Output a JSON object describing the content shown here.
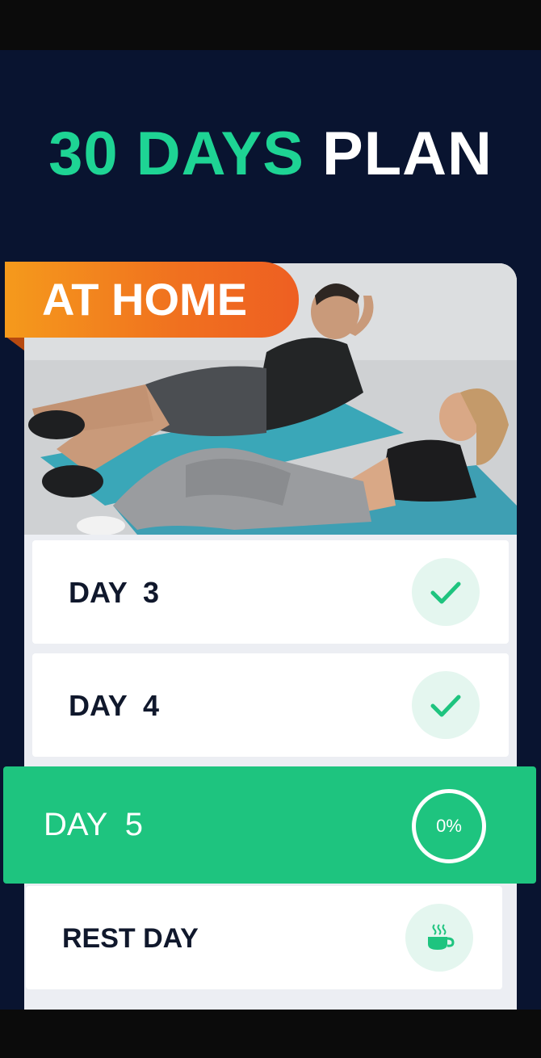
{
  "header": {
    "title_accent": "30 DAYS",
    "title_plain": "PLAN"
  },
  "plan": {
    "badge_label": "AT HOME",
    "photo_description_icon": "workout-photo"
  },
  "days": [
    {
      "label": "DAY  3",
      "status": "completed",
      "icon": "check-icon"
    },
    {
      "label": "DAY  4",
      "status": "completed",
      "icon": "check-icon"
    },
    {
      "label": "DAY  5",
      "status": "current",
      "progress": "0%"
    },
    {
      "label": "REST DAY",
      "status": "rest",
      "icon": "coffee-cup-icon"
    }
  ],
  "colors": {
    "background": "#091430",
    "accent_green": "#1ed494",
    "active_row": "#1ec47f",
    "badge_orange": "#f0701f",
    "text_dark": "#10182c"
  }
}
